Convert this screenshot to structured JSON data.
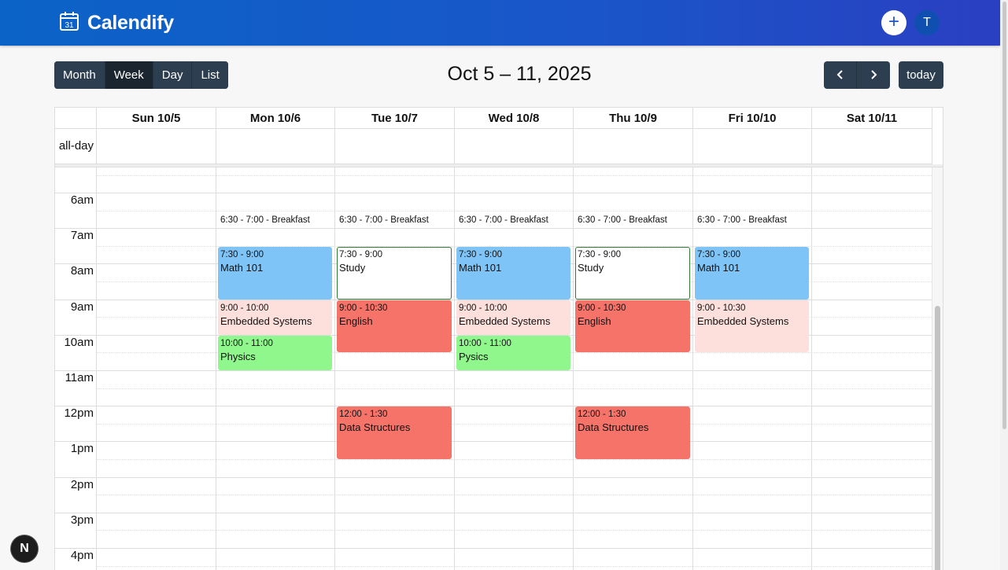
{
  "app": {
    "name": "Calendify",
    "logo_day": "31",
    "add_label": "+",
    "avatar_initial": "T"
  },
  "toolbar": {
    "views": [
      "Month",
      "Week",
      "Day",
      "List"
    ],
    "active_view": "Week",
    "title": "Oct 5 – 11, 2025",
    "prev_icon": "chevron-left-icon",
    "next_icon": "chevron-right-icon",
    "today_label": "today"
  },
  "calendar": {
    "allday_label": "all-day",
    "days": [
      "Sun 10/5",
      "Mon 10/6",
      "Tue 10/7",
      "Wed 10/8",
      "Thu 10/9",
      "Fri 10/10",
      "Sat 10/11"
    ],
    "hours": [
      "6am",
      "7am",
      "8am",
      "9am",
      "10am",
      "11am",
      "12pm",
      "1pm",
      "2pm",
      "3pm",
      "4pm"
    ],
    "events": [
      {
        "day": 1,
        "start": "6:30",
        "end": "7:00",
        "time": "6:30 - 7:00",
        "title": "Breakfast",
        "style": "plain"
      },
      {
        "day": 2,
        "start": "6:30",
        "end": "7:00",
        "time": "6:30 - 7:00",
        "title": "Breakfast",
        "style": "plain"
      },
      {
        "day": 3,
        "start": "6:30",
        "end": "7:00",
        "time": "6:30 - 7:00",
        "title": "Breakfast",
        "style": "plain"
      },
      {
        "day": 4,
        "start": "6:30",
        "end": "7:00",
        "time": "6:30 - 7:00",
        "title": "Breakfast",
        "style": "plain"
      },
      {
        "day": 5,
        "start": "6:30",
        "end": "7:00",
        "time": "6:30 - 7:00",
        "title": "Breakfast",
        "style": "plain"
      },
      {
        "day": 1,
        "start": "7:30",
        "end": "9:00",
        "time": "7:30 - 9:00",
        "title": "Math 101",
        "bg": "#7fc4f6"
      },
      {
        "day": 2,
        "start": "7:30",
        "end": "9:00",
        "time": "7:30 - 9:00",
        "title": "Study",
        "bg": "#ffffff",
        "border": "#2f7d32"
      },
      {
        "day": 3,
        "start": "7:30",
        "end": "9:00",
        "time": "7:30 - 9:00",
        "title": "Math 101",
        "bg": "#7fc4f6"
      },
      {
        "day": 4,
        "start": "7:30",
        "end": "9:00",
        "time": "7:30 - 9:00",
        "title": "Study",
        "bg": "#ffffff",
        "border": "#2f7d32"
      },
      {
        "day": 5,
        "start": "7:30",
        "end": "9:00",
        "time": "7:30 - 9:00",
        "title": "Math 101",
        "bg": "#7fc4f6"
      },
      {
        "day": 1,
        "start": "9:00",
        "end": "10:00",
        "time": "9:00 - 10:00",
        "title": "Embedded Systems",
        "bg": "#fde0dc"
      },
      {
        "day": 2,
        "start": "9:00",
        "end": "10:30",
        "time": "9:00 - 10:30",
        "title": "English",
        "bg": "#f6736a"
      },
      {
        "day": 3,
        "start": "9:00",
        "end": "10:00",
        "time": "9:00 - 10:00",
        "title": "Embedded Systems",
        "bg": "#fde0dc"
      },
      {
        "day": 4,
        "start": "9:00",
        "end": "10:30",
        "time": "9:00 - 10:30",
        "title": "English",
        "bg": "#f6736a"
      },
      {
        "day": 5,
        "start": "9:00",
        "end": "10:30",
        "time": "9:00 - 10:30",
        "title": "Embedded Systems",
        "bg": "#fde0dc"
      },
      {
        "day": 1,
        "start": "10:00",
        "end": "11:00",
        "time": "10:00 - 11:00",
        "title": "Physics",
        "bg": "#90f78c"
      },
      {
        "day": 3,
        "start": "10:00",
        "end": "11:00",
        "time": "10:00 - 11:00",
        "title": "Pysics",
        "bg": "#90f78c"
      },
      {
        "day": 2,
        "start": "12:00",
        "end": "13:30",
        "time": "12:00 - 1:30",
        "title": "Data Structures",
        "bg": "#f6736a"
      },
      {
        "day": 4,
        "start": "12:00",
        "end": "13:30",
        "time": "12:00 - 1:30",
        "title": "Data Structures",
        "bg": "#f6736a"
      }
    ]
  },
  "badge": {
    "label": "N"
  }
}
